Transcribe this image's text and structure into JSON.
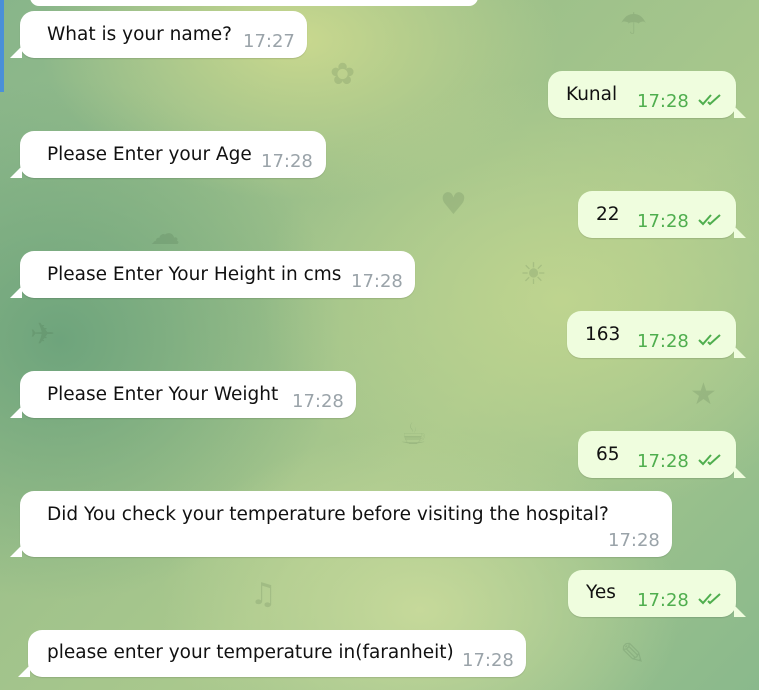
{
  "chat": {
    "messages": [
      {
        "dir": "in",
        "text": "What is your name?",
        "time": "17:27"
      },
      {
        "dir": "out",
        "text": "Kunal",
        "time": "17:28",
        "status": "read-double-check-icon"
      },
      {
        "dir": "in",
        "text": "Please Enter your Age",
        "time": "17:28"
      },
      {
        "dir": "out",
        "text": "22",
        "time": "17:28",
        "status": "read-double-check-icon"
      },
      {
        "dir": "in",
        "text": "Please Enter Your Height in cms",
        "time": "17:28"
      },
      {
        "dir": "out",
        "text": "163",
        "time": "17:28",
        "status": "read-double-check-icon"
      },
      {
        "dir": "in",
        "text": "Please Enter Your Weight",
        "time": "17:28"
      },
      {
        "dir": "out",
        "text": "65",
        "time": "17:28",
        "status": "read-double-check-icon"
      },
      {
        "dir": "in",
        "text": "Did You check your temperature before visiting the hospital?",
        "time": "17:28"
      },
      {
        "dir": "out",
        "text": "Yes",
        "time": "17:28",
        "status": "read-double-check-icon"
      },
      {
        "dir": "in",
        "text": "please enter your temperature in(faranheit)",
        "time": "17:28"
      }
    ]
  },
  "colors": {
    "incoming_bubble": "#ffffff",
    "outgoing_bubble": "#effdde",
    "outgoing_time": "#4fae4e",
    "incoming_time": "#9aa3a9"
  }
}
